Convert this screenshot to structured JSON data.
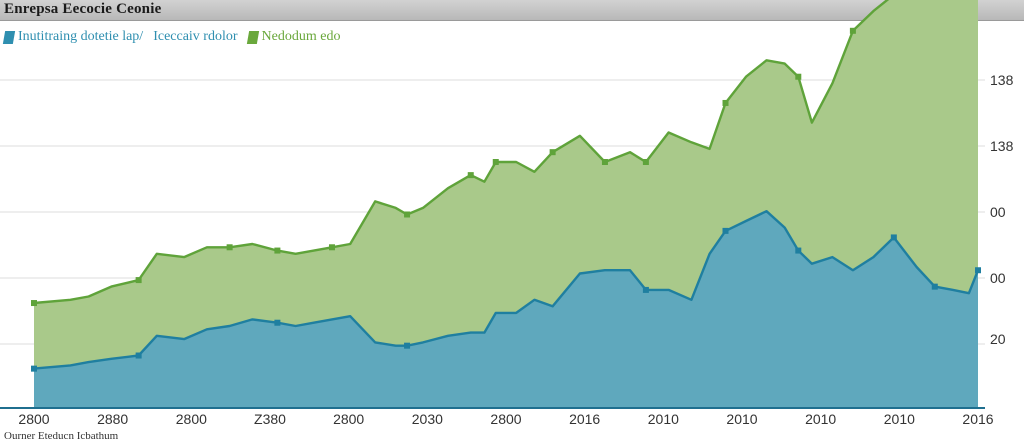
{
  "window": {
    "title": "Enrepsa Eecocie Ceonie"
  },
  "legend": [
    {
      "label": "Inutitraing  dotetie lap/",
      "color": "#2f8fb0"
    },
    {
      "label": "Iceccaiv rdolor",
      "color": "#2f8fb0"
    },
    {
      "label": "Nedodum edo",
      "color": "#6aa83c"
    }
  ],
  "source": "Ourner Eteducn Icbathum",
  "colors": {
    "upper_fill": "#a9c98a",
    "upper_line": "#5fa33a",
    "lower_fill": "#5fa8bd",
    "lower_line": "#1f7fa0",
    "grid": "#dcdcdc",
    "text": "#333333"
  },
  "chart_data": {
    "type": "area",
    "title": "Enrepsa Eecocie Ceonie",
    "x_tick_labels": [
      "2800",
      "2880",
      "2800",
      "Z380",
      "2800",
      "2030",
      "2800",
      "2016",
      "2010",
      "2010",
      "2010",
      "2010",
      "2016"
    ],
    "y_tick_labels": [
      "138",
      "138",
      "00",
      "00",
      "20"
    ],
    "ylim": [
      0,
      100
    ],
    "grid": true,
    "legend_position": "top-left",
    "x": [
      0,
      1.6,
      2.4,
      3.4,
      4.6,
      5.4,
      6.6,
      7.6,
      8.6,
      9.6,
      10.7,
      11.5,
      12.3,
      13.1,
      13.9,
      15.0,
      15.9,
      16.4,
      17.1,
      18.2,
      19.2,
      19.8,
      20.3,
      21.2,
      22.0,
      22.8,
      24.0,
      25.1,
      26.2,
      26.9,
      27.9,
      28.9,
      29.7,
      30.4,
      31.3,
      32.2,
      33.0,
      33.6,
      34.2,
      35.1,
      36.0,
      36.9,
      37.8,
      38.8,
      39.6,
      40.4,
      41.1,
      41.5
    ],
    "series": [
      {
        "name": "Inutitraing  dotetie lap/",
        "values": [
          12,
          13,
          14,
          15,
          16,
          22,
          21,
          24,
          25,
          27,
          26,
          25,
          26,
          27,
          28,
          20,
          19,
          19,
          20,
          22,
          23,
          23,
          29,
          29,
          33,
          31,
          41,
          42,
          42,
          36,
          36,
          33,
          47,
          54,
          57,
          60,
          55,
          48,
          44,
          46,
          42,
          46,
          52,
          43,
          37,
          36,
          35,
          42
        ]
      },
      {
        "name": "Iceccaiv rdolor",
        "values": [
          20,
          20,
          20,
          22,
          23,
          25,
          25,
          25,
          24,
          23,
          22,
          22,
          22,
          22,
          22,
          43,
          42,
          40,
          41,
          45,
          48,
          46,
          46,
          46,
          39,
          47,
          42,
          33,
          36,
          39,
          48,
          48,
          32,
          39,
          44,
          46,
          50,
          53,
          43,
          53,
          73,
          75,
          74,
          87,
          98,
          101,
          108,
          111
        ]
      }
    ]
  }
}
